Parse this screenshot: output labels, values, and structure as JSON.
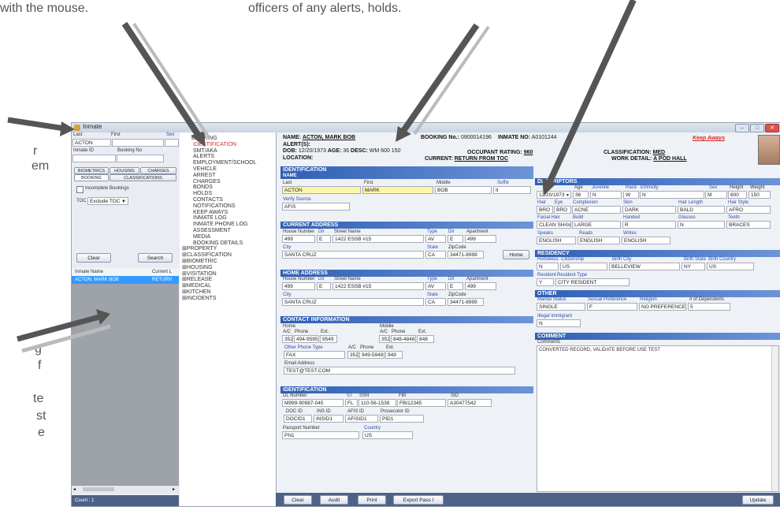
{
  "captions": {
    "top_left": "with the mouse.",
    "top_center": "officers of any alerts, holds.",
    "left_fragments": [
      "r",
      "em",
      "g",
      "f",
      "te",
      "st",
      "e"
    ]
  },
  "window": {
    "title": "Inmate"
  },
  "search": {
    "last_label": "Last",
    "first_label": "First",
    "sex_label": "Sex",
    "last_value": "ACTON",
    "inmate_id_label": "Inmate ID",
    "booking_no_label": "Booking No",
    "tabs_row1": [
      "BIOMETRICS",
      "HOUSING",
      "CHARGES"
    ],
    "tabs_row2": [
      "BOOKING",
      "CLASSIFICATIONS"
    ],
    "incomplete_label": "Incomplete Bookings",
    "toc_label": "TOC",
    "toc_value": "Exclude TOC",
    "clear": "Clear",
    "search": "Search",
    "col_name": "Inmate Name",
    "col_current": "Current L",
    "row_name": "ACTON, MARK BOB",
    "row_current": "RETURN",
    "count": "Count : 1"
  },
  "nav": {
    "booking_children": [
      "BOOKING",
      "IDENTIFICATION",
      "SMT/AKA",
      "ALERTS",
      "EMPLOYMENT/SCHOOL",
      "VEHICLE",
      "ARREST",
      "CHARGES",
      "BONDS",
      "HOLDS",
      "CONTACTS",
      "NOTIFICATIONS",
      "KEEP AWAYS",
      "INMATE LOG",
      "INMATE PHONE LOG",
      "ASSESSMENT",
      "MEDIA",
      "BOOKING DETAILS"
    ],
    "top_level": [
      "PROPERTY",
      "CLASSIFICATION",
      "BIOMETRIC",
      "HOUSING",
      "VISITATION",
      "RELEASE",
      "MEDICAL",
      "KITCHEN",
      "INCIDENTS"
    ]
  },
  "header": {
    "name_label": "NAME:",
    "name_value": "ACTON, MARK BOB",
    "booking_label": "BOOKING No.:",
    "booking_value": "0900014196",
    "inmate_no_label": "INMATE NO:",
    "inmate_no_value": "A0101244",
    "keep_away": "Keep Aways",
    "alerts_label": "ALERT(S):",
    "dob_label": "DOB:",
    "dob_value": "12/20/1973",
    "age_label": "AGE:",
    "age_value": "36",
    "desc_label": "DESC:",
    "desc_value": "WM 600 150",
    "occ_label": "OCCUPANT RATING:",
    "occ_value": "960",
    "class_label": "CLASSIFICATION:",
    "class_value": "MED",
    "location_label": "LOCATION:",
    "current_label": "CURRENT:",
    "current_value": "RETURN FROM TOC",
    "work_label": "WORK DETAIL:",
    "work_value": "A POD HALL"
  },
  "ident": {
    "section": "IDENTIFICATION",
    "sub": "NAME",
    "last_label": "Last",
    "first_label": "First",
    "middle_label": "Middle",
    "suffix_label": "Suffix",
    "last": "ACTON",
    "first": "MARK",
    "middle": "BOB",
    "suffix": "II",
    "verify_label": "Verify Source",
    "verify": "AFIS"
  },
  "current_address": {
    "section": "CURRENT ADDRESS",
    "house_label": "House Number",
    "dir_label": "Dir",
    "street_label": "Street Name",
    "type_label": "Type",
    "dir2_label": "Dir",
    "apt_label": "Apartment",
    "house": "499",
    "dir": "E",
    "street": "1422 ESSB #15",
    "type": "AV",
    "dir2": "E",
    "apt": "499",
    "city_label": "City",
    "state_label": "State",
    "zip_label": "ZipCode",
    "city": "SANTA CRUZ",
    "state": "CA",
    "zip": "34471-8999",
    "home_btn": "Home"
  },
  "home_address": {
    "section": "HOME ADDRESS",
    "house_label": "House Number",
    "dir_label": "Dir",
    "street_label": "Street Name",
    "type_label": "Type",
    "dir2_label": "Dir",
    "apt_label": "Apartment",
    "house": "499",
    "dir": "E",
    "street": "1422 ESSB #15",
    "type": "AV",
    "dir2": "E",
    "apt": "499",
    "city_label": "City",
    "state_label": "State",
    "zip_label": "ZipCode",
    "city": "SANTA CRUZ",
    "state": "CA",
    "zip": "34471-8999"
  },
  "contact": {
    "section": "CONTACT INFORMATION",
    "home_label": "Home",
    "mobile_label": "Mobile",
    "ac_label": "A/C",
    "phone_label": "Phone",
    "ext_label": "Ext.",
    "home_ac": "352",
    "home_phone": "494-9595",
    "home_ext": "9549",
    "mob_ac": "352",
    "mob_phone": "848-4848",
    "mob_ext": "848",
    "other_type_label": "Other Phone Type",
    "other_type": "FAX",
    "other_ac": "352",
    "other_phone": "949-5949",
    "other_ext": "949",
    "email_label": "Email Address",
    "email": "TEST@TEST.COM"
  },
  "ident2": {
    "section": "IDENTIFICATION",
    "dl_label": "DL Number",
    "st_label": "ST",
    "ssn_label": "SSN",
    "fbi_label": "FBI",
    "sid_label": "SID",
    "dl": "M999-90987-045",
    "st": "FL",
    "ssn": "110-56-1538",
    "fbi": "FBI12345",
    "sid": "A30477542",
    "doc_label": "DOC ID",
    "ins_label": "INS ID",
    "afis_label": "AFIS ID",
    "pros_label": "Prosecutor ID",
    "doc": "DOCID1",
    "ins": "INSID1",
    "afis": "AFISID1",
    "pros": "PID1",
    "passport_label": "Passport Number",
    "country_label": "Country",
    "passport": "PN1",
    "country": "US"
  },
  "descriptors": {
    "section": "DESCRIPTORS",
    "age_label": "Age",
    "juv_label": "Juvenile",
    "race_label": "Race",
    "eth_label": "Ethnicity",
    "sex_label": "Sex",
    "height_label": "Height",
    "weight_label": "Weight",
    "dob": "12/20/1973",
    "age": "36",
    "juv": "N",
    "race": "W",
    "eth": "N",
    "sex": "M",
    "height": "600",
    "weight": "150",
    "hair_label": "Hair",
    "eye_label": "Eye",
    "complexion_label": "Complexion",
    "skin_label": "Skin",
    "hairlen_label": "Hair Length",
    "hairstyle_label": "Hair Style",
    "hair": "BRO",
    "eye": "BRO",
    "complexion": "ACNE",
    "skin": "DARK",
    "hairlen": "BALD",
    "hairstyle": "AFRO",
    "facial_label": "Facial Hair",
    "build_label": "Build",
    "handed_label": "Handed",
    "glasses_label": "Glasses",
    "teeth_label": "Teeth",
    "facial": "CLEAN SHAVE",
    "build": "LARGE",
    "handed": "R",
    "glasses": "N",
    "teeth": "BRACES",
    "speaks_label": "Speaks",
    "reads_label": "Reads",
    "writes_label": "Writes",
    "speaks": "ENGLISH",
    "reads": "ENGLISH",
    "writes": "ENGLISH"
  },
  "residency": {
    "section": "RESIDENCY",
    "homeless_label": "Homeless",
    "citizenship_label": "Citizenship",
    "birth_city_label": "Birth City",
    "birth_state_label": "Birth State",
    "birth_country_label": "Birth Country",
    "homeless": "N",
    "citizenship": "US",
    "birth_city": "BELLEVIEW",
    "birth_state": "NY",
    "birth_country": "US",
    "resident_label": "Resident",
    "resident_type_label": "Resident Type",
    "resident": "Y",
    "resident_type": "CITY RESIDENT"
  },
  "other": {
    "section": "OTHER",
    "marital_label": "Marital Status",
    "sexpref_label": "Sexual Preference",
    "religion_label": "Religion",
    "dependents_label": "# of Dependents",
    "marital": "SINGLE",
    "sexpref": "F",
    "religion": "NO PREFERENCE",
    "dependents": "5",
    "illegal_label": "Illegal Immigrant",
    "illegal": "N"
  },
  "comment": {
    "section": "COMMENT",
    "label": "Comments",
    "text": "CONVERTED RECORD, VALIDATE BEFORE USE TEST"
  },
  "footer": {
    "clear": "Clear",
    "audit": "Audit",
    "print": "Print",
    "export": "Export Pass I",
    "update": "Update"
  }
}
